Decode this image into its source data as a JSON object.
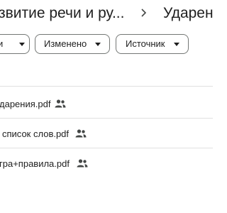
{
  "breadcrumb": {
    "parent": "звитие речи и ру...",
    "current": "Ударен"
  },
  "filters": {
    "type_label": "и",
    "modified_label": "Изменено",
    "source_label": "Источник"
  },
  "files": [
    {
      "name": "дарения.pdf",
      "shared_icon": "people-icon"
    },
    {
      "name": "список слов.pdf",
      "shared_icon": "people-icon"
    },
    {
      "name": "гра+правила.pdf",
      "shared_icon": "people-icon"
    }
  ]
}
